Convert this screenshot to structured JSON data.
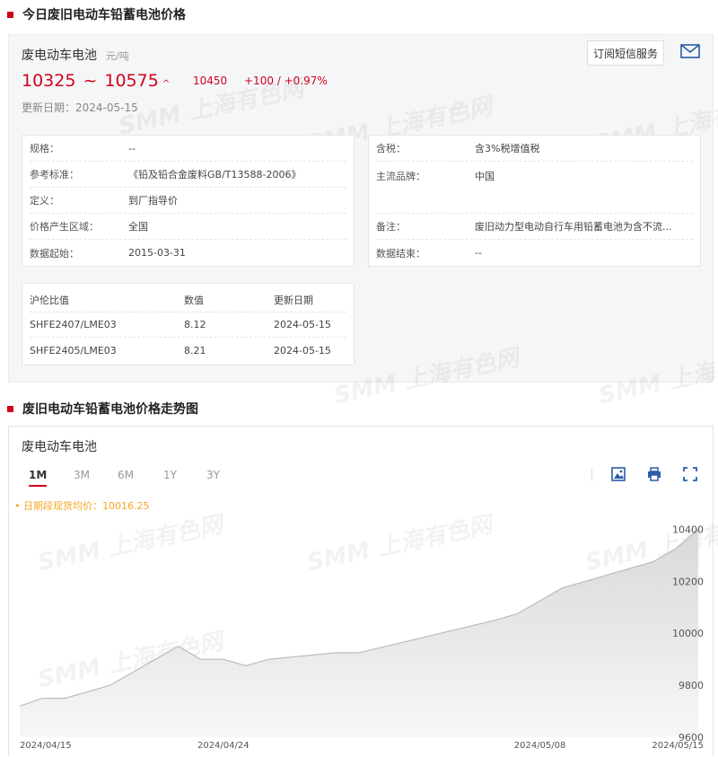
{
  "section1": {
    "title": "今日废旧电动车铅蓄电池价格"
  },
  "product": {
    "name": "废电动车电池",
    "unit": "元/吨",
    "low": "10325",
    "tilde": "~",
    "high": "10575",
    "up_arrow": "^",
    "avg": "10450",
    "change": "+100  /  +0.97%",
    "date": "更新日期：2024-05-15",
    "subscribe_label": "订阅短信服务"
  },
  "specs_left": [
    {
      "key": "规格：",
      "value": "--"
    },
    {
      "key": "参考标准：",
      "value": "《铅及铅合金废料GB/T13588-2006》"
    },
    {
      "key": "定义：",
      "value": "到厂指导价"
    },
    {
      "key": "价格产生区域：",
      "value": "全国"
    },
    {
      "key": "数据起始：",
      "value": "2015-03-31"
    }
  ],
  "specs_right": [
    {
      "key": "含税：",
      "value": "含3%税增值税"
    },
    {
      "key": "主流品牌：",
      "value": "中国"
    },
    {
      "key": "备注：",
      "value": "废旧动力型电动自行车用铅蓄电池为含不流..."
    },
    {
      "key": "数据结束：",
      "value": "--"
    }
  ],
  "ratio_table": {
    "headers": [
      "沪伦比值",
      "数值",
      "更新日期"
    ],
    "rows": [
      [
        "SHFE2407/LME03",
        "8.12",
        "2024-05-15"
      ],
      [
        "SHFE2405/LME03",
        "8.21",
        "2024-05-15"
      ]
    ]
  },
  "section2": {
    "title": "废旧电动车铅蓄电池价格走势图"
  },
  "chart_panel": {
    "name": "废电动车电池",
    "tabs": [
      "1M",
      "3M",
      "6M",
      "1Y",
      "3Y"
    ],
    "active_tab": "1M",
    "legend": "• 日期段现货均价：10016.25",
    "tools": [
      "image-download-icon",
      "print-icon",
      "fullscreen-icon"
    ]
  },
  "watermark": "SMM 上海有色网",
  "colors": {
    "accent": "#d0021b",
    "legend": "#f5a623",
    "area_fill": "#e9e9e9",
    "line": "#bbbbbb"
  },
  "chart_data": {
    "type": "area",
    "x": [
      "2024-04-15",
      "2024-04-16",
      "2024-04-17",
      "2024-04-18",
      "2024-04-19",
      "2024-04-22",
      "2024-04-23",
      "2024-04-24",
      "2024-04-25",
      "2024-04-26",
      "2024-04-29",
      "2024-04-30",
      "2024-05-06",
      "2024-05-07",
      "2024-05-08",
      "2024-05-09",
      "2024-05-10",
      "2024-05-13",
      "2024-05-14",
      "2024-05-15"
    ],
    "values": [
      9720,
      9750,
      9750,
      9775,
      9800,
      9950,
      9900,
      9900,
      9875,
      9900,
      9925,
      9925,
      10050,
      10075,
      10125,
      10175,
      10200,
      10275,
      10325,
      10400
    ],
    "x_tick_labels": [
      "2024/04/15",
      "2024/04/24",
      "2024/05/08",
      "2024/05/15"
    ],
    "x_tick_dates": [
      "2024-04-15",
      "2024-04-24",
      "2024-05-08",
      "2024-05-15"
    ],
    "y_ticks": [
      9600,
      9800,
      10000,
      10200,
      10400
    ],
    "ylim": [
      9600,
      10450
    ],
    "title": "",
    "xlabel": "",
    "ylabel": "",
    "grid": false,
    "legend": "top-left"
  }
}
